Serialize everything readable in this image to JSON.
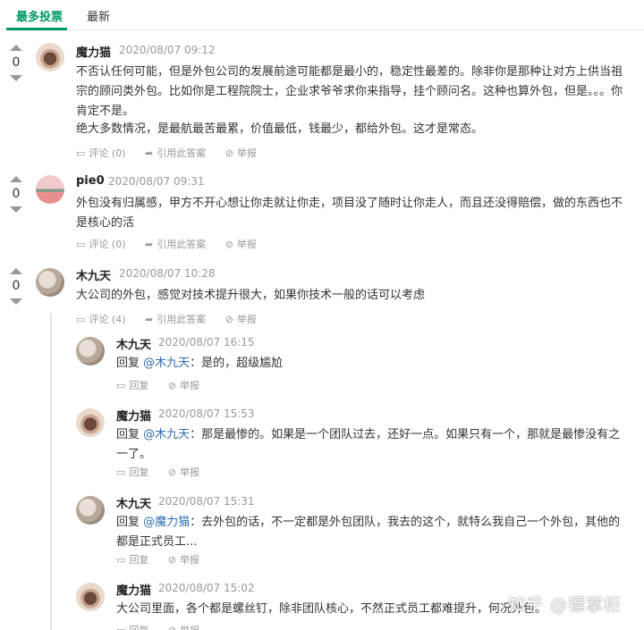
{
  "tabs": [
    {
      "label": "最多投票"
    },
    {
      "label": "最新"
    }
  ],
  "actions": {
    "comment": "评论",
    "cite": "引用此答案",
    "report": "举报",
    "reply": "回复",
    "reply_prefix": "回复"
  },
  "answers": [
    {
      "votes": "0",
      "author": "魔力猫",
      "time": "2020/08/07 09:12",
      "p1": "不否认任何可能，但是外包公司的发展前途可能都是最小的，稳定性最差的。除非你是那种让对方上供当祖宗的顾问类外包。比如你是工程院院士，企业求爷爷求你来指导，挂个顾问名。这种也算外包，但是。。。你肯定不是。",
      "p2": "绝大多数情况，是最航最苦最累，价值最低，钱最少，都给外包。这才是常态。",
      "comment_count": "评论 (0)"
    },
    {
      "votes": "0",
      "author": "pie0",
      "time": "2020/08/07 09:31",
      "p1": "外包没有归属感，甲方不开心想让你走就让你走，项目没了随时让你走人，而且还没得赔偿，做的东西也不是核心的活",
      "comment_count": "评论 (0)"
    },
    {
      "votes": "0",
      "author": "木九天",
      "time": "2020/08/07 10:28",
      "p1": "大公司的外包，感觉对技术提升很大，如果你技术一般的话可以考虑",
      "comment_count": "评论 (4)"
    }
  ],
  "replies": [
    {
      "author": "木九天",
      "time": "2020/08/07 16:15",
      "mention": "@木九天",
      "text": "：是的，超级尴尬"
    },
    {
      "author": "魔力猫",
      "time": "2020/08/07 15:53",
      "mention": "@木九天",
      "text": "：那是最惨的。如果是一个团队过去，还好一点。如果只有一个，那就是最惨没有之一了。"
    },
    {
      "author": "木九天",
      "time": "2020/08/07 15:31",
      "mention": "@魔力猫",
      "text": "：去外包的话，不一定都是外包团队，我去的这个，就特么我自己一个外包，其他的都是正式员工..."
    },
    {
      "author": "魔力猫",
      "time": "2020/08/07 15:02",
      "text": "大公司里面，各个都是螺丝钉，除非团队核心，不然正式员工都难提升，何况外包。"
    }
  ],
  "watermark": "知乎 @镖掌柜"
}
